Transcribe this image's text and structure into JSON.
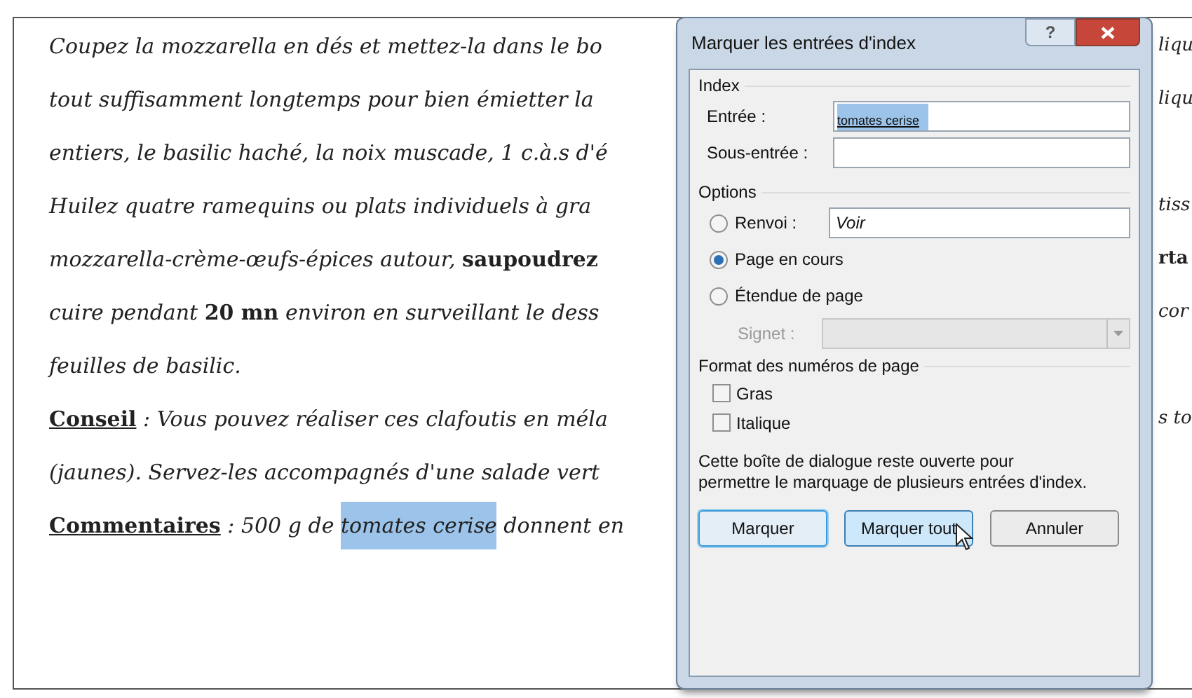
{
  "document": {
    "lines": [
      {
        "segments": [
          {
            "kind": "plain",
            "text": "Coupez la mozzarella en dés et mettez-la dans le bo"
          }
        ],
        "right": "liqu"
      },
      {
        "segments": [
          {
            "kind": "plain",
            "text": "tout suffisamment longtemps pour bien émietter la"
          }
        ],
        "right": "liqu"
      },
      {
        "segments": [
          {
            "kind": "plain",
            "text": "entiers, le basilic haché, la noix muscade, 1 c.à.s d'é"
          }
        ]
      },
      {
        "segments": [
          {
            "kind": "plain",
            "text": "Huilez quatre ramequins ou plats individuels à gra"
          }
        ],
        "right": "tiss"
      },
      {
        "segments": [
          {
            "kind": "plain",
            "text": "mozzarella-crème-œufs-épices autour, "
          },
          {
            "kind": "bold",
            "text": "saupoudrez"
          }
        ],
        "right": "rta",
        "right_bold": true
      },
      {
        "segments": [
          {
            "kind": "plain",
            "text": "cuire pendant "
          },
          {
            "kind": "bold",
            "text": "20 mn"
          },
          {
            "kind": "plain",
            "text": " environ en surveillant le dess"
          }
        ],
        "right": "cor"
      },
      {
        "segments": [
          {
            "kind": "plain",
            "text": "feuilles de basilic."
          }
        ]
      },
      {
        "segments": [
          {
            "kind": "heading",
            "text": "Conseil"
          },
          {
            "kind": "plain",
            "text": " : Vous pouvez réaliser ces clafoutis en méla"
          }
        ],
        "right": "s to"
      },
      {
        "segments": [
          {
            "kind": "plain",
            "text": "(jaunes). Servez-les accompagnés d'une salade vert"
          }
        ]
      },
      {
        "segments": [
          {
            "kind": "heading",
            "text": "Commentaires"
          },
          {
            "kind": "plain",
            "text": " : 500 g de "
          },
          {
            "kind": "highlight",
            "text": "tomates cerise"
          },
          {
            "kind": "plain",
            "text": " donnent en"
          }
        ]
      }
    ]
  },
  "dialog": {
    "title": "Marquer les entrées d'index",
    "help_button": "?",
    "index_group": {
      "title": "Index",
      "entry": {
        "label": "Entrée :",
        "value": "tomates cerise",
        "selected": true
      },
      "subentry": {
        "label": "Sous-entrée :"
      }
    },
    "options_group": {
      "title": "Options",
      "radios": [
        {
          "label": "Renvoi :",
          "selected": false,
          "field_value": "Voir"
        },
        {
          "label": "Page en cours",
          "selected": true
        },
        {
          "label": "Étendue de page",
          "selected": false
        }
      ],
      "bookmark": {
        "label": "Signet :",
        "disabled": true
      }
    },
    "format_group": {
      "title": "Format des numéros de page",
      "checkboxes": [
        {
          "label": "Gras",
          "checked": false
        },
        {
          "label": "Italique",
          "checked": false
        }
      ]
    },
    "note": "Cette boîte de dialogue reste ouverte pour permettre le marquage de plusieurs entrées d'index.",
    "buttons": [
      {
        "label": "Marquer",
        "default": true,
        "hovered": false
      },
      {
        "label": "Marquer tout",
        "default": false,
        "hovered": true
      },
      {
        "label": "Annuler",
        "default": false,
        "hovered": false
      }
    ]
  }
}
